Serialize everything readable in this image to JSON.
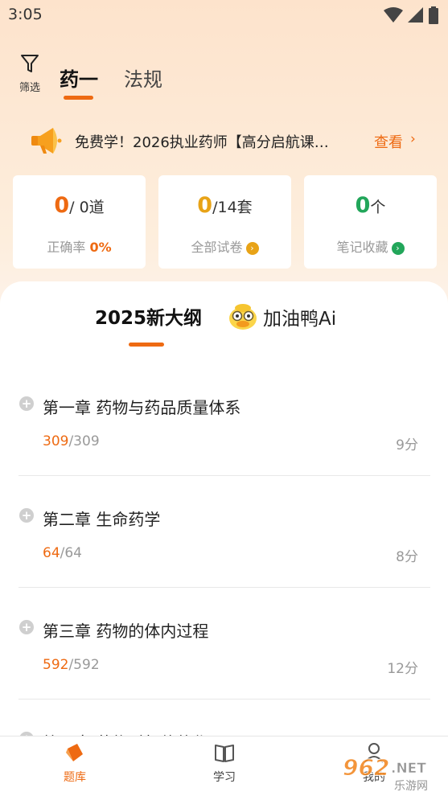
{
  "status_bar": {
    "time": "3:05"
  },
  "header": {
    "filter_label": "筛选",
    "tabs": [
      {
        "label": "药一",
        "active": true
      },
      {
        "label": "法规",
        "active": false
      }
    ]
  },
  "notice": {
    "text": "免费学！2026执业药师【高分启航课…",
    "link_label": "查看",
    "arrow": "›"
  },
  "stats": [
    {
      "value": "0",
      "unit": "/ 0道",
      "label": "正确率",
      "label_value": "0%",
      "color": "#ee6a12"
    },
    {
      "value": "0",
      "unit": "/14套",
      "label": "全部试卷",
      "color": "#e8a317"
    },
    {
      "value": "0",
      "unit": "个",
      "label": "笔记收藏",
      "color": "#22a65a"
    }
  ],
  "outline": {
    "tabs": [
      {
        "label": "2025新大纲",
        "active": true
      },
      {
        "label": "加油鸭Ai",
        "active": false
      }
    ]
  },
  "chapters": [
    {
      "title": "第一章 药物与药品质量体系",
      "done": "309",
      "total": "/309",
      "minutes": "9分"
    },
    {
      "title": "第二章 生命药学",
      "done": "64",
      "total": "/64",
      "minutes": "8分"
    },
    {
      "title": "第三章 药物的体内过程",
      "done": "592",
      "total": "/592",
      "minutes": "12分"
    },
    {
      "title": "第四章 药物对机体的作用",
      "done": "",
      "total": "",
      "minutes": ""
    }
  ],
  "bottom_nav": [
    {
      "label": "题库",
      "active": true
    },
    {
      "label": "学习",
      "active": false
    },
    {
      "label": "我的",
      "active": false
    }
  ],
  "watermark": {
    "text": "962.NET",
    "subtext": "乐游网"
  },
  "colors": {
    "accent": "#ee6a12",
    "yellow": "#e8a317",
    "green": "#22a65a"
  }
}
